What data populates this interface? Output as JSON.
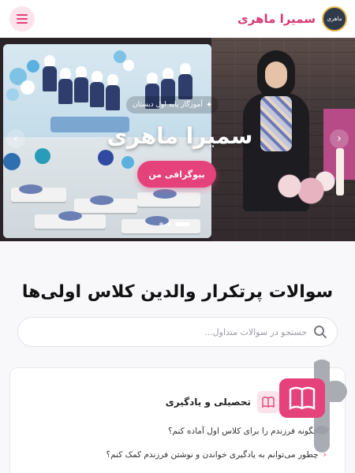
{
  "header": {
    "site_name": "سمیرا ماهری",
    "logo_text": "ماهری",
    "menu_icon": "hamburger-menu-icon"
  },
  "hero": {
    "badge": "آموزگار پایه اول دبستان",
    "title": "سمیرا ماهری",
    "button_label": "بیوگرافی من",
    "prev_arrow": "‹",
    "next_arrow": "›",
    "slides_count": 3,
    "active_slide": 1
  },
  "faq": {
    "title": "سوالات پرتکرار والدین کلاس اولی‌ها",
    "search_placeholder": "جستجو در سوالات متداول...",
    "category": "تحصیلی و یادگیری",
    "questions": [
      "چگونه فرزندم را برای کلاس اول آماده کنم؟",
      "چطور می‌توانم به یادگیری خواندن و نوشتن فرزندم کمک کنم؟"
    ]
  },
  "colors": {
    "accent": "#e5417b",
    "brand": "#d63a72",
    "badge_gray": "#9b9ea6"
  }
}
